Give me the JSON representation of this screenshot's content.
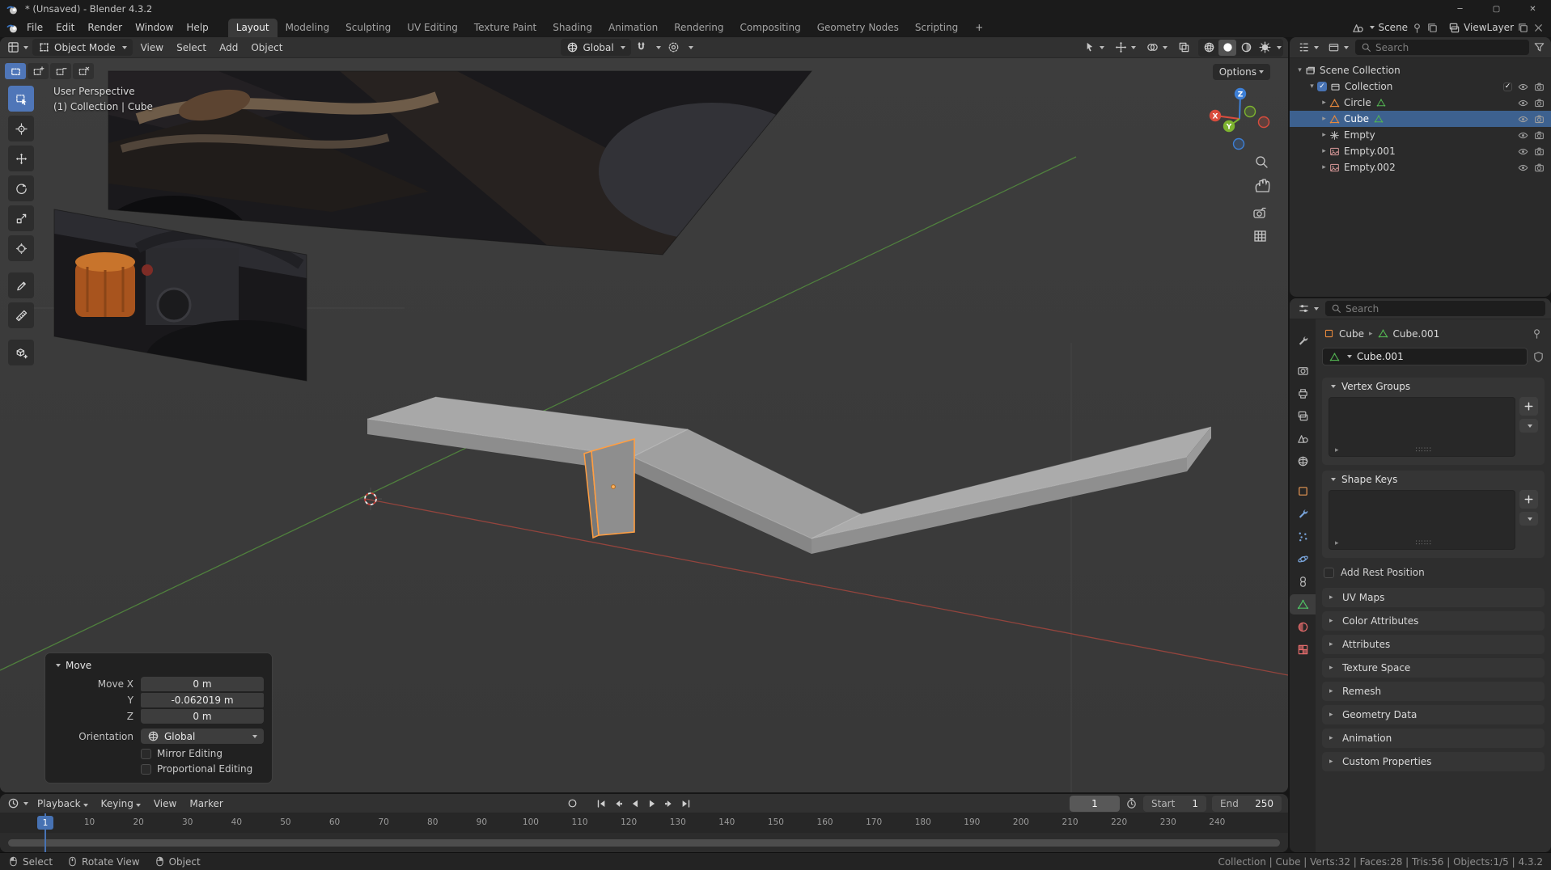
{
  "colors": {
    "accent": "#4772b3",
    "object_orange": "#e8893c",
    "selection_outline": "#ff9e42",
    "mesh_data_green": "#53b552",
    "axis_x": "#a3473e",
    "axis_y": "#55913e",
    "gizmo_x": "#d94c3d",
    "gizmo_y": "#7db32f",
    "gizmo_z": "#3d7fd6"
  },
  "titlebar": {
    "title": "* (Unsaved) - Blender 4.3.2"
  },
  "topbar": {
    "menus": [
      "File",
      "Edit",
      "Render",
      "Window",
      "Help"
    ],
    "workspaces": [
      "Layout",
      "Modeling",
      "Sculpting",
      "UV Editing",
      "Texture Paint",
      "Shading",
      "Animation",
      "Rendering",
      "Compositing",
      "Geometry Nodes",
      "Scripting"
    ],
    "active_workspace": "Layout",
    "add_tab": "+",
    "scene": "Scene",
    "view_layer": "ViewLayer"
  },
  "viewport": {
    "header": {
      "mode": "Object Mode",
      "menus": [
        "View",
        "Select",
        "Add",
        "Object"
      ],
      "orientation": "Global"
    },
    "overlay": {
      "perspective": "User Perspective",
      "context": "(1) Collection | Cube",
      "options": "Options"
    },
    "gizmo": {
      "x": "X",
      "y": "Y",
      "z": "Z"
    },
    "tools": [
      "select-box",
      "cursor",
      "move",
      "rotate",
      "scale",
      "transform",
      "annotate",
      "measure",
      "add-cube"
    ],
    "active_tool": "select-box",
    "select_modes": [
      "set",
      "extend",
      "subtract",
      "difference"
    ]
  },
  "operator_panel": {
    "title": "Move",
    "rows": [
      {
        "label": "Move X",
        "value": "0 m"
      },
      {
        "label": "Y",
        "value": "-0.062019 m"
      },
      {
        "label": "Z",
        "value": "0 m"
      }
    ],
    "orientation_label": "Orientation",
    "orientation_value": "Global",
    "checkboxes": [
      {
        "label": "Mirror Editing",
        "checked": false
      },
      {
        "label": "Proportional Editing",
        "checked": false
      }
    ]
  },
  "timeline": {
    "menus": [
      "Playback",
      "Keying",
      "View",
      "Marker"
    ],
    "menus_with_chevron": [
      "Playback",
      "Keying"
    ],
    "playback": [
      "jump-start",
      "prev-keyframe",
      "play-reverse",
      "play",
      "next-keyframe",
      "jump-end"
    ],
    "current_frame": "1",
    "frame_field": "1",
    "start_label": "Start",
    "start_value": "1",
    "end_label": "End",
    "end_value": "250",
    "ticks": [
      10,
      20,
      30,
      40,
      50,
      60,
      70,
      80,
      90,
      100,
      110,
      120,
      130,
      140,
      150,
      160,
      170,
      180,
      190,
      200,
      210,
      220,
      230,
      240
    ]
  },
  "statusbar": {
    "hints": [
      {
        "icon": "mouse-left",
        "label": "Select"
      },
      {
        "icon": "mouse-middle",
        "label": "Rotate View"
      },
      {
        "icon": "mouse-right",
        "label": "Object"
      }
    ],
    "info": "Collection | Cube | Verts:32 | Faces:28 | Tris:56 | Objects:1/5 | 4.3.2"
  },
  "outliner": {
    "search_placeholder": "Search",
    "rows": [
      {
        "label": "Scene Collection",
        "type": "scene-collection",
        "depth": 0,
        "expanded": true
      },
      {
        "label": "Collection",
        "type": "collection",
        "depth": 1,
        "expanded": true,
        "checkbox": true
      },
      {
        "label": "Circle",
        "type": "mesh",
        "depth": 2
      },
      {
        "label": "Cube",
        "type": "mesh",
        "depth": 2,
        "selected": true
      },
      {
        "label": "Empty",
        "type": "empty",
        "depth": 2
      },
      {
        "label": "Empty.001",
        "type": "image",
        "depth": 2
      },
      {
        "label": "Empty.002",
        "type": "image",
        "depth": 2
      }
    ]
  },
  "properties": {
    "search_placeholder": "Search",
    "tabs": [
      "tool",
      "render",
      "output",
      "view-layer",
      "scene",
      "world",
      "object",
      "modifiers",
      "particles",
      "physics",
      "constraints",
      "object-data",
      "material",
      "texture"
    ],
    "active_tab": "object-data",
    "breadcrumb": {
      "object": "Cube",
      "data": "Cube.001"
    },
    "name_field": "Cube.001",
    "vertex_groups_title": "Vertex Groups",
    "shape_keys_title": "Shape Keys",
    "rest_position_label": "Add Rest Position",
    "closed_panels": [
      "UV Maps",
      "Color Attributes",
      "Attributes",
      "Texture Space",
      "Remesh",
      "Geometry Data",
      "Animation",
      "Custom Properties"
    ]
  }
}
